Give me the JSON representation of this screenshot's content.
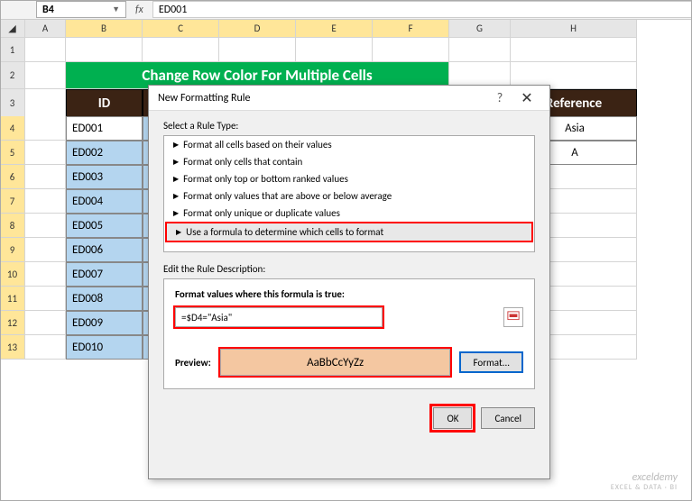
{
  "namebox": "B4",
  "fx_label": "fx",
  "formula_bar": "ED001",
  "columns": [
    "A",
    "B",
    "C",
    "D",
    "E",
    "F",
    "G",
    "H"
  ],
  "rows_nums": [
    "1",
    "2",
    "3",
    "4",
    "5",
    "6",
    "7",
    "8",
    "9",
    "10",
    "11",
    "12",
    "13"
  ],
  "title": "Change Row Color For Multiple Cells",
  "header_id": "ID",
  "header_ref": "Reference",
  "ids": [
    "ED001",
    "ED002",
    "ED003",
    "ED004",
    "ED005",
    "ED006",
    "ED007",
    "ED008",
    "ED009",
    "ED010"
  ],
  "refs": [
    "Asia",
    "A"
  ],
  "dialog": {
    "title": "New Formatting Rule",
    "help": "?",
    "close": "✕",
    "select_label": "Select a Rule Type:",
    "rules": [
      "Format all cells based on their values",
      "Format only cells that contain",
      "Format only top or bottom ranked values",
      "Format only values that are above or below average",
      "Format only unique or duplicate values",
      "Use a formula to determine which cells to format"
    ],
    "edit_label": "Edit the Rule Description:",
    "formula_label": "Format values where this formula is true:",
    "formula_value": "=$D4=\"Asia\"",
    "preview_label": "Preview:",
    "preview_text": "AaBbCcYyZz",
    "format_btn": "Format...",
    "ok": "OK",
    "cancel": "Cancel"
  },
  "watermark": {
    "main": "exceldemy",
    "sub": "EXCEL & DATA · BI"
  },
  "colors": {
    "title_bg": "#00B050",
    "header_bg": "#3b2314",
    "sel": "#b4d5ef",
    "preview": "#f4c7a1",
    "hl": "#ff0000"
  }
}
